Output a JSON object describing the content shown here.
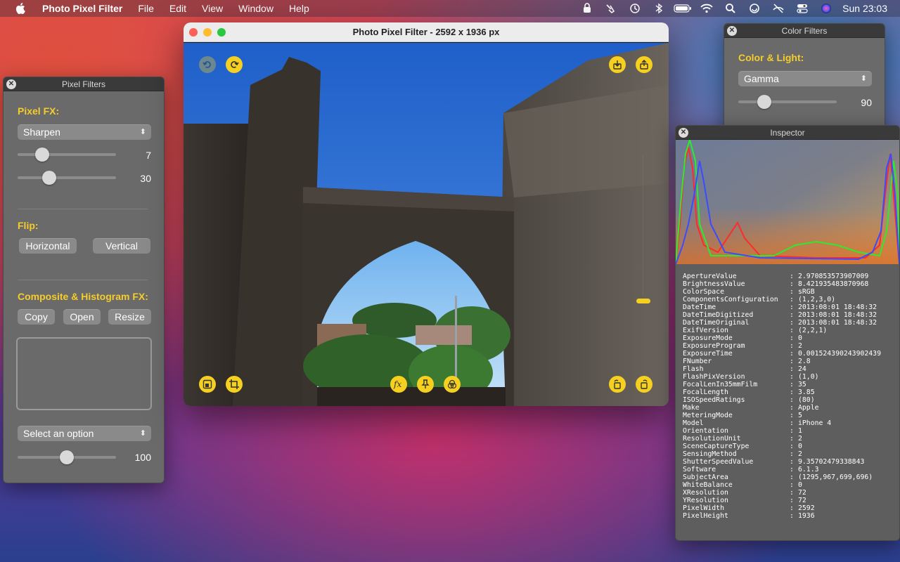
{
  "menubar": {
    "app_name": "Photo Pixel Filter",
    "items": [
      "File",
      "Edit",
      "View",
      "Window",
      "Help"
    ],
    "clock": "Sun 23:03",
    "status_icons": [
      "privacy-icon",
      "finger-icon",
      "history-icon",
      "bluetooth-icon",
      "battery-icon",
      "wifi-icon",
      "search-icon",
      "sync-icon",
      "mute-icon",
      "control-center-icon",
      "siri-icon"
    ]
  },
  "main_window": {
    "title": "Photo Pixel Filter - 2592 x 1936 px"
  },
  "pixel_filters": {
    "title": "Pixel Filters",
    "pixel_fx_label": "Pixel FX:",
    "pixel_fx_select": "Sharpen",
    "slider1_value": "7",
    "slider2_value": "30",
    "flip_label": "Flip:",
    "flip_horizontal": "Horizontal",
    "flip_vertical": "Vertical",
    "composite_label": "Composite & Histogram FX:",
    "copy_button": "Copy",
    "open_button": "Open",
    "resize_button": "Resize",
    "option_select": "Select an option",
    "slider3_value": "100"
  },
  "color_filters": {
    "title": "Color Filters",
    "section_label": "Color & Light:",
    "select": "Gamma",
    "slider_value": "90"
  },
  "inspector": {
    "title": "Inspector",
    "rows": [
      {
        "key": "ApertureValue",
        "value": "2.970853573907009"
      },
      {
        "key": "BrightnessValue",
        "value": "8.421935483870968"
      },
      {
        "key": "ColorSpace",
        "value": "sRGB"
      },
      {
        "key": "ComponentsConfiguration",
        "value": "(1,2,3,0)"
      },
      {
        "key": "DateTime",
        "value": "2013:08:01 18:48:32"
      },
      {
        "key": "DateTimeDigitized",
        "value": "2013:08:01 18:48:32"
      },
      {
        "key": "DateTimeOriginal",
        "value": "2013:08:01 18:48:32"
      },
      {
        "key": "ExifVersion",
        "value": "(2,2,1)"
      },
      {
        "key": "ExposureMode",
        "value": "0"
      },
      {
        "key": "ExposureProgram",
        "value": "2"
      },
      {
        "key": "ExposureTime",
        "value": "0.001524390243902439"
      },
      {
        "key": "FNumber",
        "value": "2.8"
      },
      {
        "key": "Flash",
        "value": "24"
      },
      {
        "key": "FlashPixVersion",
        "value": "(1,0)"
      },
      {
        "key": "FocalLenIn35mmFilm",
        "value": "35"
      },
      {
        "key": "FocalLength",
        "value": "3.85"
      },
      {
        "key": "ISOSpeedRatings",
        "value": "(80)"
      },
      {
        "key": "Make",
        "value": "Apple"
      },
      {
        "key": "MeteringMode",
        "value": "5"
      },
      {
        "key": "Model",
        "value": "iPhone 4"
      },
      {
        "key": "Orientation",
        "value": "1"
      },
      {
        "key": "ResolutionUnit",
        "value": "2"
      },
      {
        "key": "SceneCaptureType",
        "value": "0"
      },
      {
        "key": "SensingMethod",
        "value": "2"
      },
      {
        "key": "ShutterSpeedValue",
        "value": "9.35702479338843"
      },
      {
        "key": "Software",
        "value": "6.1.3"
      },
      {
        "key": "SubjectArea",
        "value": "(1295,967,699,696)"
      },
      {
        "key": "WhiteBalance",
        "value": "0"
      },
      {
        "key": "XResolution",
        "value": "72"
      },
      {
        "key": "YResolution",
        "value": "72"
      },
      {
        "key": "PixelWidth",
        "value": "2592"
      },
      {
        "key": "PixelHeight",
        "value": "1936"
      }
    ]
  },
  "colors": {
    "accent_yellow": "#f5cd2b",
    "panel_bg": "#6a6a6a"
  }
}
